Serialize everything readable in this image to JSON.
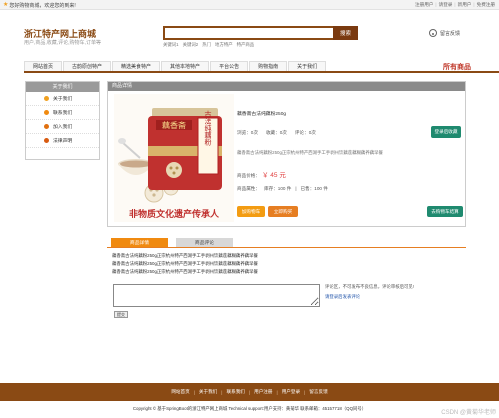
{
  "topbar": {
    "welcome": "您好购物商城，欢迎您的到来!",
    "links": [
      "注册用户",
      "请登录",
      "新用户",
      "免费注册"
    ]
  },
  "header": {
    "title": "浙江特产网上商城",
    "subtitle": "用户,商品,收藏,评论,购物车,订单等",
    "search_placeholder": "",
    "search_button": "搜索",
    "hotwords": [
      "关键词1",
      "关键词2",
      "热门",
      "地方特产",
      "特产商品"
    ],
    "service": "留言反馈"
  },
  "nav": {
    "items": [
      "网站首页",
      "古韵原创特产",
      "精选美食特产",
      "其他本地特产",
      "平台公告",
      "购物指南",
      "关于我们"
    ],
    "all_goods": "所有商品"
  },
  "sidebar": {
    "title": "关于我们",
    "items": [
      "关于我们",
      "联系我们",
      "加入我们",
      "法律声明"
    ]
  },
  "product": {
    "panel_title": "商品详情",
    "name": "藕香斋古法纯藕粉250g",
    "browse_label": "浏览：",
    "browse": "0次",
    "collect_label": "收藏：",
    "collect": "0次",
    "comment_label": "评论：",
    "comment": "0次",
    "fav_button": "登录后收藏",
    "desc": "藕香斋古法纯藕粉250g正宗杭州特产西湖手工手剥州饮藕莲藕糊藕养藕早餐",
    "price_label": "商品价格：",
    "price": "￥ 45 元",
    "attr_label": "商品属性：",
    "stock": "库存：100 件",
    "sold": "已售：100 件",
    "btn_cart": "加购物车",
    "btn_buy": "立即购买",
    "btn_back": "去购物车结算",
    "image": {
      "brand": "藕香斋",
      "side_text": "古法纯藕粉",
      "banner": "非物质文化遗产传承人"
    }
  },
  "tabs": {
    "items": [
      "商品详情",
      "商品评论"
    ],
    "content_lines": [
      "藕香斋古法纯藕粉250g正宗杭州特产西湖手工手剥州饮藕莲藕糊藕养藕早餐",
      "藕香斋古法纯藕粉250g正宗杭州特产西湖手工手剥州饮藕莲藕糊藕养藕早餐",
      "藕香斋古法纯藕粉250g正宗杭州特产西湖手工手剥州饮藕莲藕糊藕养藕早餐"
    ]
  },
  "comments": {
    "note": "评论区，不可发布不良信息，评论审核后可见!",
    "login_link": "请登录后发表评论",
    "submit": "提交"
  },
  "footer": {
    "links": [
      "网站首页",
      "关于我们",
      "联系我们",
      "用户注册",
      "用户登录",
      "留言反馈"
    ],
    "copyright": "Copyright © 基于SpringBoot的浙江特产网上商城   Technical support:用户支持：黄菊华   联系邮箱：45157718（QQ同号）",
    "watermark": "CSDN @黄菊华老师"
  },
  "colors": {
    "brand": "#8a4a14",
    "accent": "#f08a10",
    "price": "#e04040",
    "green": "#1f8a6f"
  }
}
